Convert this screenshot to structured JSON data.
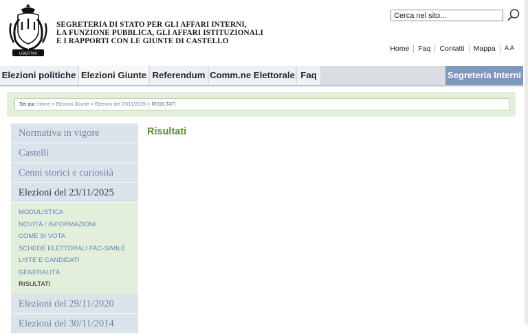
{
  "header": {
    "org_title": {
      "line1": "SEGRETERIA DI STATO PER GLI AFFARI INTERNI,",
      "line2": "LA FUNZIONE PUBBLICA, GLI AFFARI ISTITUZIONALI",
      "line3": "E I RAPPORTI CON LE GIUNTE DI CASTELLO"
    },
    "logo_icon": "san-marino-coat-of-arms-icon",
    "logo_motto": "LIBERTAS",
    "search": {
      "value": "Cerca nel sito...",
      "icon": "search-icon"
    },
    "util_links": [
      "Home",
      "Faq",
      "Contatti",
      "Mappa",
      "A A"
    ]
  },
  "nav": {
    "tabs": [
      "Elezioni politiche",
      "Elezioni Giunte",
      "Referendum",
      "Comm.ne Elettorale",
      "Faq"
    ],
    "active_tab": "Elezioni Giunte",
    "right_label": "Segreteria Interni"
  },
  "breadcrumb": {
    "label": "Sei qui:",
    "items": [
      "Home",
      "Elezioni Giunte",
      "Elezioni del 23/11/2025",
      "RISULTATI"
    ],
    "separator": ">"
  },
  "sidebar": {
    "items_top": [
      "Normativa in vigore",
      "Castelli",
      "Cenni storici e curiosità"
    ],
    "current_section": "Elezioni del 23/11/2025",
    "submenu": [
      "MODULISTICA",
      "NOVITÀ / INFORMAZIONI",
      "COME SI VOTA",
      "SCHEDE ELETTORALI FAC-SIMILE",
      "LISTE E CANDIDATI",
      "GENERALITÀ",
      "RISULTATI"
    ],
    "selected_submenu": "RISULTATI",
    "items_bottom": [
      "Elezioni del 29/11/2020",
      "Elezioni del 30/11/2014"
    ]
  },
  "main": {
    "title": "Risultati"
  },
  "colors": {
    "nav_right_bg": "#7d97bd",
    "content_title": "#5c8b3c",
    "submenu_bg": "#e3efda",
    "sidebar_bg": "#dde3ea",
    "link_blue": "#5e86b8"
  }
}
